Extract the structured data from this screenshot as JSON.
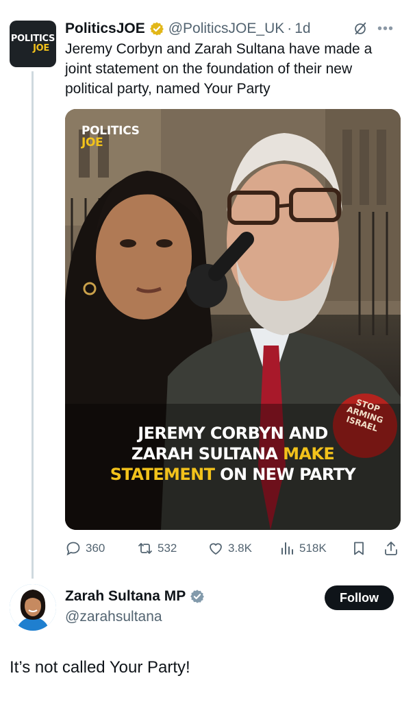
{
  "original_tweet": {
    "author": {
      "avatar_text_line1": "POLITICS",
      "avatar_text_line2": "JOE",
      "name": "PoliticsJOE",
      "verified": "gold-verified-badge",
      "handle": "@PoliticsJOE_UK",
      "time": "1d"
    },
    "text": "Jeremy Corbyn and Zarah Sultana have made a joint statement on the foundation of their new political party, named Your Party",
    "media": {
      "logo_line1": "POLITICS",
      "logo_line2": "JOE",
      "headline": {
        "line1": "JEREMY CORBYN AND",
        "line2_white": "ZARAH SULTANA ",
        "line2_yellow": "MAKE",
        "line3_yellow": "STATEMENT",
        "line3_white": " ON NEW PARTY"
      },
      "badge": {
        "line1": "STOP",
        "line2": "ARMING",
        "line3": "ISRAEL"
      }
    },
    "actions": {
      "replies": "360",
      "reposts": "532",
      "likes": "3.8K",
      "views": "518K"
    }
  },
  "reply": {
    "author": {
      "name": "Zarah Sultana MP",
      "verified": "grey-verified-badge",
      "handle": "@zarahsultana"
    },
    "follow_label": "Follow",
    "text": "It’s not called Your Party!"
  },
  "colors": {
    "text_primary": "#0f1419",
    "text_secondary": "#536471",
    "brand_yellow": "#f2c21b",
    "follow_bg": "#0f1419",
    "thread_line": "#cfd9de"
  }
}
